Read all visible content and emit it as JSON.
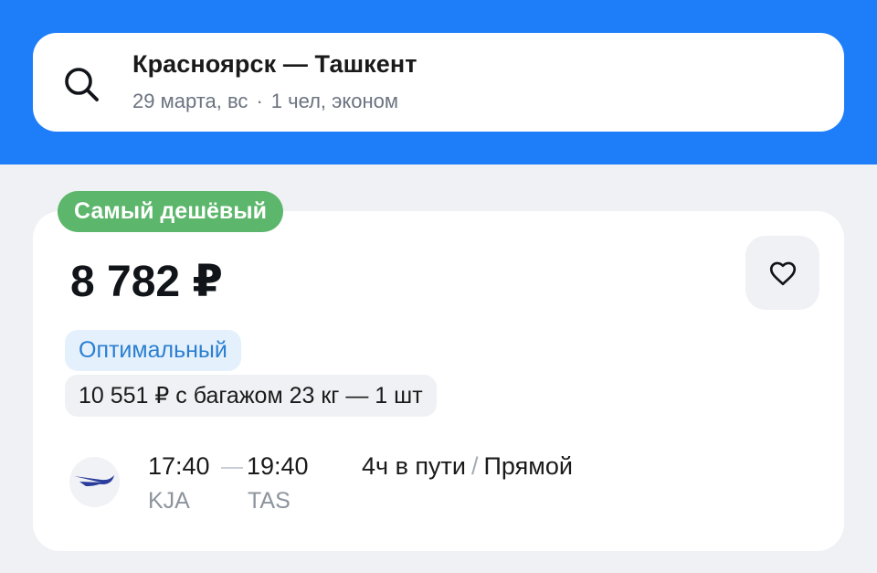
{
  "search": {
    "route": "Красноярск — Ташкент",
    "date": "29 марта, вс",
    "separator": "·",
    "passengers": "1 чел, эконом"
  },
  "ticket": {
    "badge": "Самый дешёвый",
    "price": "8 782 ₽",
    "tag_optimal": "Оптимальный",
    "baggage_option": "10 551 ₽ с багажом 23 кг — 1 шт",
    "flight": {
      "departure_time": "17:40",
      "arrival_time": "19:40",
      "departure_code": "KJA",
      "arrival_code": "TAS",
      "duration": "4ч в пути",
      "slash": "/",
      "stops": "Прямой"
    }
  },
  "icons": {
    "search": "search-icon",
    "favorite": "heart-icon",
    "airline": "airline-logo-icon"
  },
  "colors": {
    "header_bg": "#1e7ef9",
    "badge_green": "#5cb66b",
    "tag_blue_text": "#2b7ed1",
    "tag_blue_bg": "#e4f1fc",
    "page_bg": "#eff1f4"
  }
}
